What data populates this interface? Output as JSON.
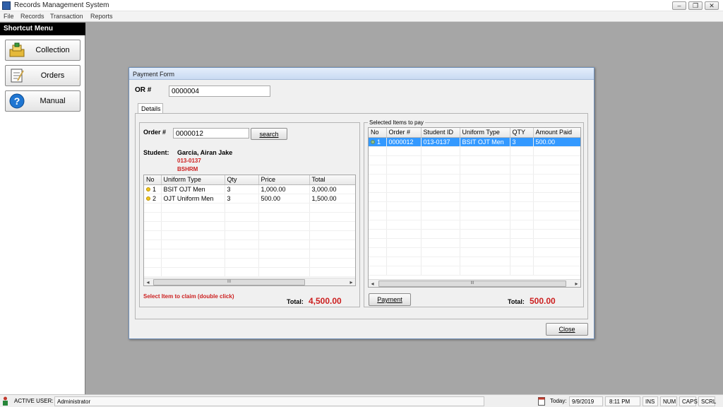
{
  "app": {
    "title": "Records Management System"
  },
  "window_controls": {
    "minimize": "–",
    "restore": "❐",
    "close": "✕"
  },
  "menu": [
    "File",
    "Records",
    "Transaction",
    "Reports"
  ],
  "sidebar": {
    "header": "Shortcut Menu",
    "items": [
      {
        "label": "Collection",
        "icon": "collection-icon"
      },
      {
        "label": "Orders",
        "icon": "orders-icon"
      },
      {
        "label": "Manual",
        "icon": "help-icon"
      }
    ]
  },
  "dialog": {
    "title": "Payment Form",
    "or_label": "OR #",
    "or_value": "0000004",
    "tab": "Details",
    "order_label": "Order #",
    "order_value": "0000012",
    "search_label": "search",
    "student_label": "Student:",
    "student_name": "Garcia, Airan Jake",
    "student_id": "013-0137",
    "student_course": "BSHRM",
    "items_grid": {
      "columns": [
        "No",
        "Uniform Type",
        "Qty",
        "Price",
        "Total"
      ],
      "rows": [
        {
          "no": "1",
          "type": "BSIT OJT Men",
          "qty": "3",
          "price": "1,000.00",
          "total": "3,000.00"
        },
        {
          "no": "2",
          "type": "OJT Uniform Men",
          "qty": "3",
          "price": "500.00",
          "total": "1,500.00"
        }
      ]
    },
    "hint": "Select Item to claim (double click)",
    "left_total_label": "Total:",
    "left_total_value": "4,500.00",
    "selected_group_label": "Selected Items to pay",
    "selected_grid": {
      "columns": [
        "No",
        "Order #",
        "Student ID",
        "Uniform Type",
        "QTY",
        "Amount Paid"
      ],
      "rows": [
        {
          "no": "1",
          "order": "0000012",
          "student_id": "013-0137",
          "type": "BSIT OJT Men",
          "qty": "3",
          "amount": "500.00"
        }
      ]
    },
    "payment_label": "Payment",
    "right_total_label": "Total:",
    "right_total_value": "500.00",
    "close_label": "Close",
    "scroll_thumb": "III"
  },
  "status": {
    "active_user_label": "ACTIVE USER:",
    "active_user": "Administrator",
    "today_label": "Today:",
    "date": "9/9/2019",
    "time": "8:11 PM",
    "ins": "INS",
    "num": "NUM",
    "caps": "CAPS",
    "scrl": "SCRL"
  },
  "colors": {
    "accent_red": "#cc1f1f",
    "selection": "#3399ff",
    "sidebar_header": "#000000"
  }
}
